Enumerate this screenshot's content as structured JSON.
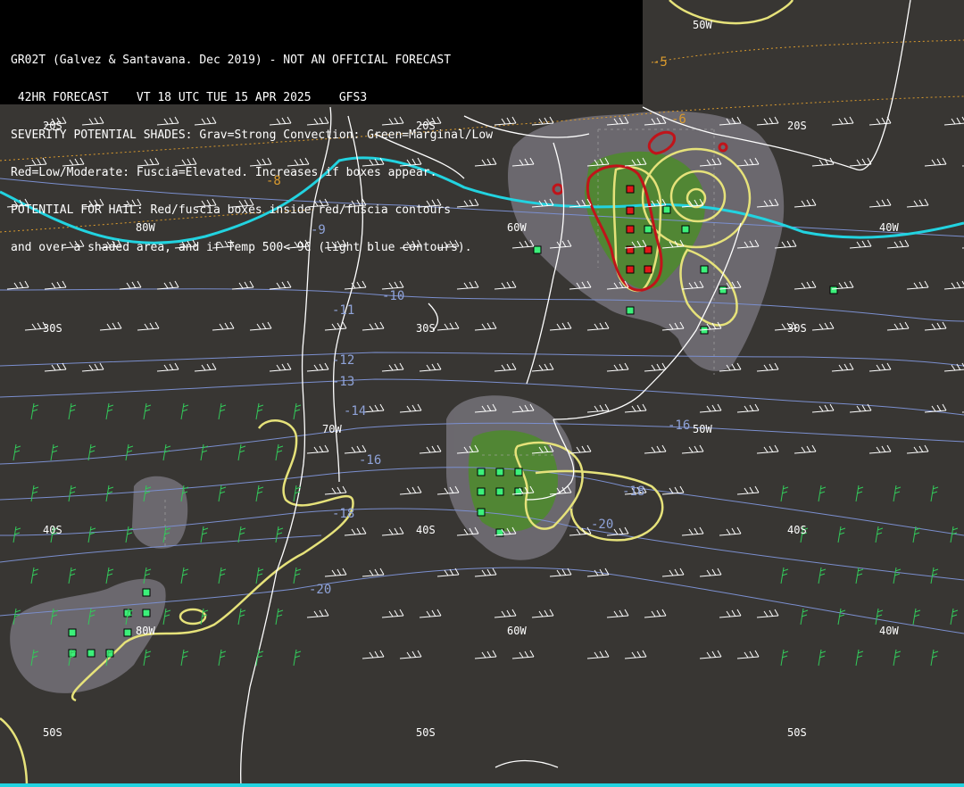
{
  "header": {
    "lines": [
      "GR02T (Galvez & Santavana. Dec 2019) - NOT AN OFFICIAL FORECAST",
      " 42HR FORECAST    VT 18 UTC TUE 15 APR 2025    GFS3",
      "SEVERITY POTENTIAL SHADES: Grav=Strong Convection: Green=Marginal/Low",
      "Red=Low/Moderate: Fuscia=Elevated. Increases if boxes appear.",
      "POTENTIAL FOR HAIL: Red/fuscia boxes inside red/fuscia contours",
      "and over a shaded area, and if Temp 500<-9C (light blue contours)."
    ]
  },
  "grid_labels": {
    "lat_20s_left": "20S",
    "lat_20s_mid": "20S",
    "lat_20s_right": "20S",
    "lon_80w": "80W",
    "lon_60w_top": "60W",
    "lon_40w_top": "40W",
    "lon_50w_top": "50W",
    "lat_30s_left": "30S",
    "lat_30s_mid": "30S",
    "lat_30s_right": "30S",
    "lon_70w": "70W",
    "lon_50w_mid": "50W",
    "lat_40s_left": "40S",
    "lat_40s_mid": "40S",
    "lat_40s_right": "40S",
    "lon_80w_low": "80W",
    "lon_60w_low": "60W",
    "lon_40w_low": "40W",
    "lat_50s_left": "50S",
    "lat_50s_mid": "50S",
    "lat_50s_right": "50S"
  },
  "temp_labels": {
    "t_m9": "-9",
    "t_m10": "-10",
    "t_m11": "-11",
    "t_m12": "-12",
    "t_m13": "-13",
    "t_m14": "-14",
    "t_m16a": "-16",
    "t_m16b": "-16",
    "t_m18a": "-18",
    "t_m18b": "-18",
    "t_m20a": "-20",
    "t_m20b": "-20"
  },
  "other_labels": {
    "o_m5": "-5",
    "o_m6": "-6",
    "o_m8": "-8"
  },
  "colors": {
    "background": "#383633",
    "gray_shade": "#6e6c72",
    "green_shade": "#4f8a2e",
    "yellow_contour": "#e6e27a",
    "red_contour": "#c0141a",
    "cyan_line": "#22d3e0",
    "temp_contour": "#7b8fcf",
    "coast": "#ffffff",
    "box_green": "#3cf07a",
    "box_red": "#e01818"
  }
}
